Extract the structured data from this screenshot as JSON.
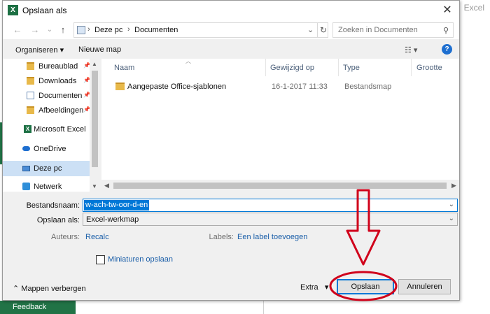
{
  "background_app": {
    "title": "Excel",
    "feedback": "Feedback"
  },
  "dialog": {
    "title": "Opslaan als",
    "close": "✕",
    "nav": {
      "back": "←",
      "forward": "→",
      "recent": "⌄",
      "up": "↑"
    },
    "address": {
      "crumbs": [
        "Deze pc",
        "Documenten"
      ],
      "chevron": "⌄",
      "refresh": "↻"
    },
    "search": {
      "placeholder": "Zoeken in Documenten",
      "icon": "⚲"
    },
    "toolbar": {
      "organize": "Organiseren ▾",
      "new_folder": "Nieuwe map",
      "view": "☷ ▾",
      "help": "?"
    },
    "sidebar": {
      "items": [
        {
          "label": "Bureaublad",
          "icon": "folder-icon",
          "pinned": true
        },
        {
          "label": "Downloads",
          "icon": "download-icon",
          "pinned": true
        },
        {
          "label": "Documenten",
          "icon": "document-icon",
          "pinned": true
        },
        {
          "label": "Afbeeldingen",
          "icon": "pictures-icon",
          "pinned": true
        },
        {
          "label": "Microsoft Excel",
          "icon": "excel-icon",
          "pinned": false
        },
        {
          "label": "OneDrive",
          "icon": "cloud-icon",
          "pinned": false
        },
        {
          "label": "Deze pc",
          "icon": "computer-icon",
          "pinned": false,
          "selected": true
        },
        {
          "label": "Netwerk",
          "icon": "network-icon",
          "pinned": false
        }
      ],
      "pin_glyph": "📌"
    },
    "file_list": {
      "columns": [
        "Naam",
        "Gewijzigd op",
        "Type",
        "Grootte"
      ],
      "rows": [
        {
          "name": "Aangepaste Office-sjablonen",
          "modified": "16-1-2017 11:33",
          "type": "Bestandsmap",
          "size": ""
        }
      ]
    },
    "form": {
      "filename_label": "Bestandsnaam:",
      "filename_value": "w-ach-tw-oor-d-en",
      "savetype_label": "Opslaan als:",
      "savetype_value": "Excel-werkmap",
      "authors_label": "Auteurs:",
      "authors_value": "Recalc",
      "labels_label": "Labels:",
      "labels_value": "Een label toevoegen",
      "thumbnails_label": "Miniaturen opslaan",
      "thumbnails_checked": false
    },
    "footer": {
      "hide_folders": "Mappen verbergen",
      "tools": "Extra",
      "save": "Opslaan",
      "cancel": "Annuleren"
    }
  },
  "colors": {
    "accent": "#0078d7",
    "excel_green": "#217346",
    "annotation_red": "#d0021b"
  }
}
